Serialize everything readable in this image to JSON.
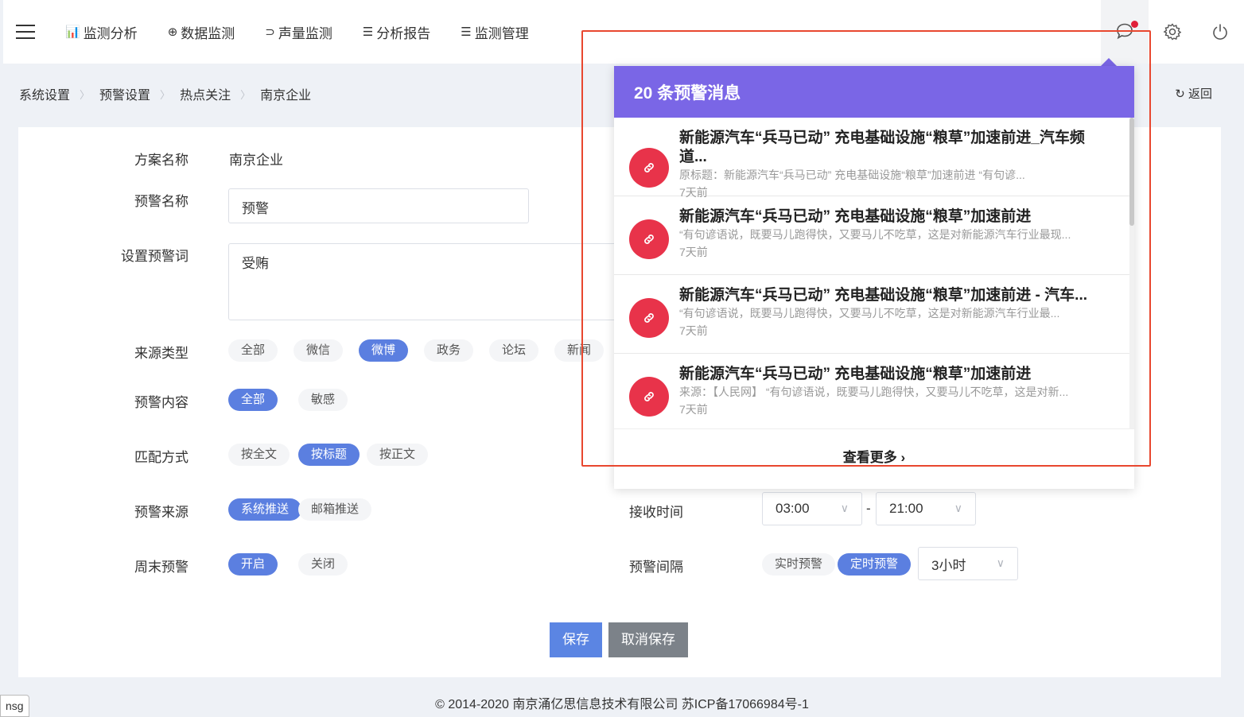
{
  "nav": {
    "items": [
      {
        "icon": "bar-chart-icon",
        "glyph": "📊",
        "label": "监测分析"
      },
      {
        "icon": "crosshair-icon",
        "glyph": "⊕",
        "label": "数据监测"
      },
      {
        "icon": "rss-icon",
        "glyph": "⊃",
        "label": "声量监测"
      },
      {
        "icon": "checklist-icon",
        "glyph": "☰",
        "label": "分析报告"
      },
      {
        "icon": "list-icon",
        "glyph": "☰",
        "label": "监测管理"
      }
    ]
  },
  "breadcrumb": [
    "系统设置",
    "预警设置",
    "热点关注",
    "南京企业"
  ],
  "back_label": "返回",
  "form": {
    "plan_name_label": "方案名称",
    "plan_name_value": "南京企业",
    "alert_name_label": "预警名称",
    "alert_name_value": "预警",
    "alert_words_label": "设置预警词",
    "alert_words_value": "受贿",
    "source_type_label": "来源类型",
    "source_types": [
      "全部",
      "微信",
      "微博",
      "政务",
      "论坛",
      "新闻"
    ],
    "source_type_selected": "微博",
    "alert_content_label": "预警内容",
    "alert_contents": [
      "全部",
      "敏感"
    ],
    "alert_content_selected": "全部",
    "match_label": "匹配方式",
    "match_modes": [
      "按全文",
      "按标题",
      "按正文"
    ],
    "match_selected": "按标题",
    "alert_source_label": "预警来源",
    "alert_sources": [
      "系统推送",
      "邮箱推送"
    ],
    "alert_source_selected": "系统推送",
    "weekend_label": "周末预警",
    "weekend_options": [
      "开启",
      "关闭"
    ],
    "weekend_selected": "开启",
    "receive_time_label": "接收时间",
    "receive_start": "03:00",
    "receive_sep": "-",
    "receive_end": "21:00",
    "interval_label": "预警间隔",
    "interval_modes": [
      "实时预警",
      "定时预警"
    ],
    "interval_selected": "定时预警",
    "interval_value": "3小时"
  },
  "buttons": {
    "save": "保存",
    "cancel_save": "取消保存"
  },
  "footer": "© 2014-2020 南京涌亿思信息技术有限公司 苏ICP备17066984号-1",
  "tooltip": "nsg",
  "popup": {
    "header": "20 条预警消息",
    "messages": [
      {
        "title": "新能源汽车“兵马已动” 充电基础设施“粮草”加速前进_汽车频道...",
        "summary": "      原标题：新能源汽车“兵马已动” 充电基础设施“粮草”加速前进      “有句谚...",
        "time": "7天前"
      },
      {
        "title": "新能源汽车“兵马已动” 充电基础设施“粮草”加速前进",
        "summary": "“有句谚语说，既要马儿跑得快，又要马儿不吃草，这是对新能源汽车行业最现...",
        "time": "7天前"
      },
      {
        "title": "新能源汽车“兵马已动” 充电基础设施“粮草”加速前进 - 汽车...",
        "summary": "   “有句谚语说，既要马儿跑得快，又要马儿不吃草，这是对新能源汽车行业最...",
        "time": "7天前"
      },
      {
        "title": "新能源汽车“兵马已动” 充电基础设施“粮草”加速前进",
        "summary": "来源：【人民网】 “有句谚语说，既要马儿跑得快，又要马儿不吃草，这是对新...",
        "time": "7天前"
      }
    ],
    "more_label": "查看更多 ›"
  }
}
